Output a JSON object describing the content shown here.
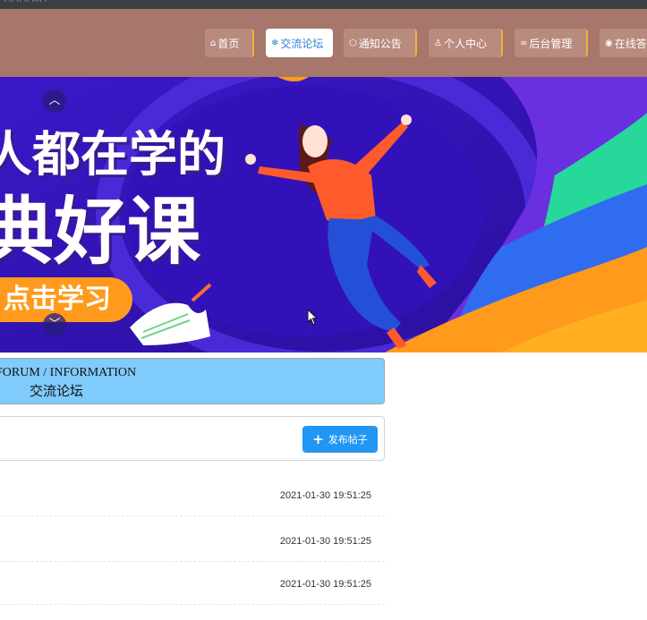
{
  "browser": {
    "title_fragment": "· ·· ·· ·· ···· ·"
  },
  "nav": {
    "items": [
      {
        "label": "首页",
        "icon": "home-icon"
      },
      {
        "label": "交流论坛",
        "icon": "snowflake-icon",
        "active": true
      },
      {
        "label": "通知公告",
        "icon": "box-icon"
      },
      {
        "label": "个人中心",
        "icon": "user-icon"
      },
      {
        "label": "后台管理",
        "icon": "link-icon"
      },
      {
        "label": "在线答",
        "icon": "circle-check-icon"
      }
    ],
    "colors": {
      "bar": "#a6776a",
      "item": "#b98a7e",
      "accent_border": "#f0b23a",
      "active_text": "#2f7fd1"
    }
  },
  "banner": {
    "line1": "人都在学的",
    "line2": "典好课",
    "cta": "点击学习",
    "prev_icon": "chevron-up-icon",
    "next_icon": "chevron-down-icon"
  },
  "forum": {
    "title_en": "FORUM / INFORMATION",
    "title_zh": "交流论坛",
    "header_bg": "#7fcbfc"
  },
  "toolbar": {
    "post_button": "发布帖子",
    "post_icon": "plus-icon"
  },
  "posts": [
    {
      "time": "2021-01-30 19:51:25"
    },
    {
      "time": "2021-01-30 19:51:25"
    },
    {
      "time": "2021-01-30 19:51:25"
    }
  ]
}
